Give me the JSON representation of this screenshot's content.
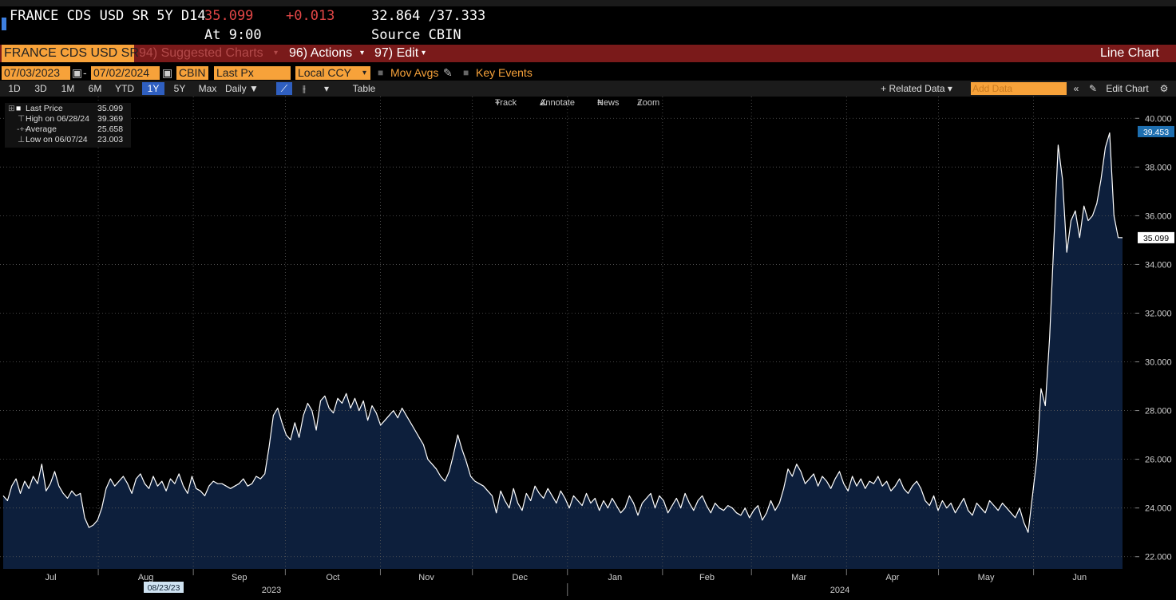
{
  "header": {
    "security": "FRANCE CDS USD SR 5Y D14",
    "last_price": "35.099",
    "change": "+0.013",
    "range": "32.864 /37.333",
    "time": "At 9:00",
    "source": "Source CBIN"
  },
  "menubar": {
    "ticker_box": "FRANCE CDS USD SR",
    "suggested": "94) Suggested Charts",
    "actions": "96) Actions",
    "edit": "97) Edit",
    "chart_type": "Line Chart"
  },
  "controls": {
    "start_date": "07/03/2023",
    "end_date": "07/02/2024",
    "source": "CBIN",
    "field": "Last Px",
    "currency": "Local CCY",
    "mov_avgs": "Mov Avgs",
    "key_events": "Key Events"
  },
  "ranges": [
    "1D",
    "3D",
    "1M",
    "6M",
    "YTD",
    "1Y",
    "5Y",
    "Max"
  ],
  "active_range": "1Y",
  "toolbar": {
    "frequency": "Daily",
    "table": "Table",
    "related": "+ Related Data",
    "add_data": "Add Data",
    "edit_chart": "Edit Chart"
  },
  "chart_tools": [
    "Track",
    "Annotate",
    "News",
    "Zoom"
  ],
  "legend": [
    {
      "label": "Last Price",
      "value": "35.099"
    },
    {
      "label": "High on 06/28/24",
      "value": "39.369"
    },
    {
      "label": "Average",
      "value": "25.658"
    },
    {
      "label": "Low on 06/07/24",
      "value": "23.003"
    }
  ],
  "colors": {
    "line": "#ffffff",
    "fill": "#0d1f3c",
    "accent": "#f7a23a",
    "menubar": "#7a1a1a",
    "price_red": "#e04646",
    "highlight": "#2f5fc0"
  },
  "chart_data": {
    "type": "area",
    "ylim": [
      21.5,
      40.5
    ],
    "y_ticks": [
      "40.000",
      "38.000",
      "36.000",
      "34.000",
      "32.000",
      "30.000",
      "28.000",
      "26.000",
      "24.000",
      "22.000"
    ],
    "x_labels": [
      "Jul",
      "Aug",
      "Sep",
      "Oct",
      "Nov",
      "Dec",
      "Jan",
      "Feb",
      "Mar",
      "Apr",
      "May",
      "Jun"
    ],
    "year_labels": [
      "2023",
      "2024"
    ],
    "cursor_date": "08/23/23",
    "value_tags": [
      "39.453",
      "35.099"
    ],
    "grid": true,
    "series": [
      {
        "values": [
          24.5,
          24.3,
          24.9,
          25.2,
          24.6,
          25.1,
          24.8,
          25.3,
          25.0,
          25.8,
          24.7,
          25.0,
          25.5,
          24.9,
          24.6,
          24.4,
          24.7,
          24.5,
          24.6,
          23.6,
          23.2,
          23.3,
          23.5,
          24.0,
          24.8,
          25.2,
          24.9,
          25.1,
          25.3,
          25.0,
          24.6,
          25.2,
          25.4,
          25.0,
          24.8,
          25.3,
          24.9,
          25.1,
          24.7,
          25.2,
          25.0,
          25.4,
          24.9,
          24.6,
          25.3,
          24.8,
          24.7,
          24.5,
          24.9,
          25.1,
          25.0,
          25.0,
          24.9,
          24.8,
          24.9,
          25.0,
          25.2,
          24.9,
          25.0,
          25.3,
          25.2,
          25.4,
          26.5,
          27.8,
          28.1,
          27.5,
          27.0,
          26.8,
          27.5,
          26.9,
          27.8,
          28.3,
          28.0,
          27.2,
          28.4,
          28.6,
          28.1,
          27.9,
          28.5,
          28.3,
          28.7,
          28.1,
          28.5,
          28.0,
          28.4,
          27.6,
          28.2,
          27.9,
          27.4,
          27.6,
          27.8,
          28.0,
          27.7,
          28.1,
          27.8,
          27.5,
          27.2,
          26.9,
          26.6,
          26.0,
          25.8,
          25.6,
          25.3,
          25.1,
          25.5,
          26.2,
          27.0,
          26.4,
          25.9,
          25.3,
          25.1,
          25.0,
          24.9,
          24.7,
          24.5,
          23.8,
          24.7,
          24.3,
          24.0,
          24.8,
          24.2,
          23.9,
          24.6,
          24.3,
          24.9,
          24.6,
          24.4,
          24.8,
          24.5,
          24.2,
          24.7,
          24.4,
          24.0,
          24.5,
          24.3,
          24.1,
          24.6,
          24.2,
          24.4,
          23.9,
          24.3,
          24.0,
          24.4,
          24.1,
          23.8,
          24.0,
          24.5,
          24.2,
          23.7,
          24.2,
          24.4,
          24.6,
          24.0,
          24.5,
          24.3,
          23.8,
          24.1,
          24.4,
          24.0,
          24.6,
          24.2,
          23.9,
          24.3,
          24.5,
          24.1,
          23.8,
          24.2,
          24.0,
          23.9,
          24.1,
          24.0,
          23.8,
          23.7,
          24.0,
          23.6,
          23.9,
          24.1,
          23.5,
          23.8,
          24.3,
          23.9,
          24.2,
          24.8,
          25.6,
          25.3,
          25.8,
          25.5,
          25.0,
          25.2,
          25.4,
          24.9,
          25.3,
          25.1,
          24.8,
          25.2,
          25.5,
          25.0,
          24.7,
          25.3,
          24.9,
          25.2,
          24.8,
          25.1,
          25.0,
          25.3,
          24.9,
          25.1,
          24.7,
          24.9,
          25.2,
          24.8,
          24.6,
          24.9,
          25.1,
          24.8,
          24.3,
          24.1,
          24.5,
          23.9,
          24.3,
          24.0,
          24.2,
          23.8,
          24.1,
          24.4,
          23.9,
          23.7,
          24.2,
          24.0,
          23.8,
          24.3,
          24.1,
          23.9,
          24.2,
          24.0,
          23.8,
          23.6,
          24.0,
          23.4,
          23.0,
          24.5,
          26.0,
          28.9,
          28.2,
          31.0,
          35.0,
          38.9,
          37.5,
          34.5,
          35.8,
          36.2,
          35.1,
          36.4,
          35.8,
          36.0,
          36.5,
          37.5,
          38.8,
          39.4,
          36.0,
          35.1,
          35.099
        ]
      }
    ]
  }
}
